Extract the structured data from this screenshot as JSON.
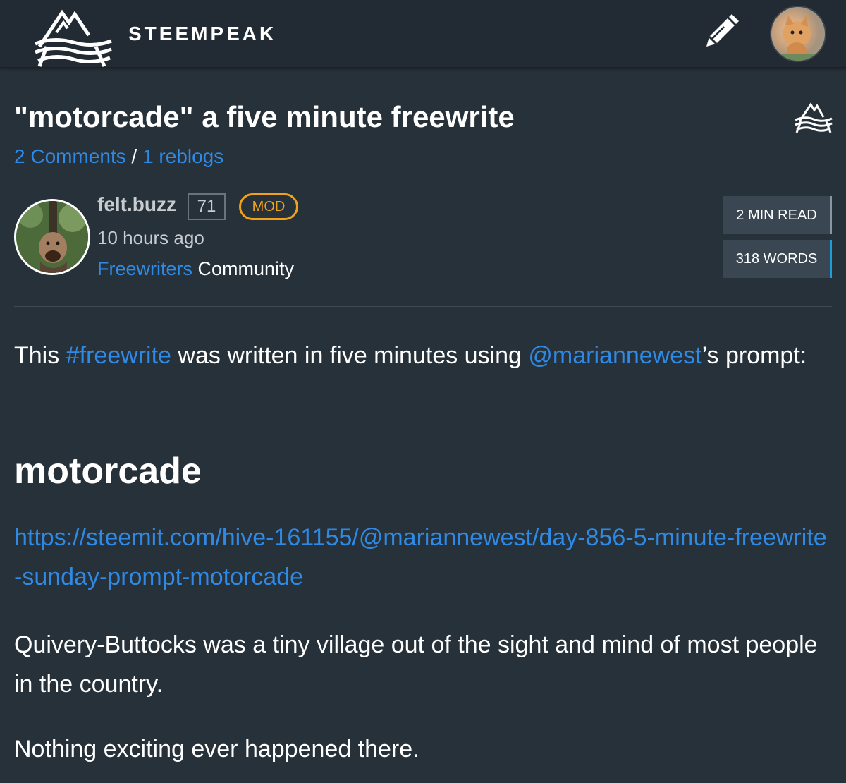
{
  "header": {
    "brand": "STEEMPEAK",
    "write_icon": "pencil-icon",
    "logo_icon": "steempeak-mountain-logo"
  },
  "post": {
    "title": "\"motorcade\" a five minute freewrite",
    "comments": "2 Comments",
    "separator": "/",
    "reblogs": "1 reblogs"
  },
  "author": {
    "name": "felt.buzz",
    "reputation": "71",
    "role_badge": "MOD",
    "time_ago": "10 hours ago",
    "community_name": "Freewriters",
    "community_suffix": " Community"
  },
  "stats": {
    "read_time": "2 MIN READ",
    "word_count": "318 WORDS"
  },
  "content": {
    "p1_before": "This ",
    "p1_tag": "#freewrite",
    "p1_middle": " was written in five minutes using ",
    "p1_mention": "@mariannewest",
    "p1_after": "’s prompt:",
    "heading": "motorcade",
    "url": "https://steemit.com/hive-161155/@mariannewest/day-856-5-minute-freewrite-sunday-prompt-motorcade",
    "p2": "Quivery-Buttocks was a tiny village out of the sight and mind of most people in the country.",
    "p3": "Nothing exciting ever happened there."
  },
  "colors": {
    "background": "#27313a",
    "header_bg": "#222b33",
    "link": "#2f8ae6",
    "mod_badge": "#f0a21b",
    "words_accent": "#1e9ed8"
  }
}
